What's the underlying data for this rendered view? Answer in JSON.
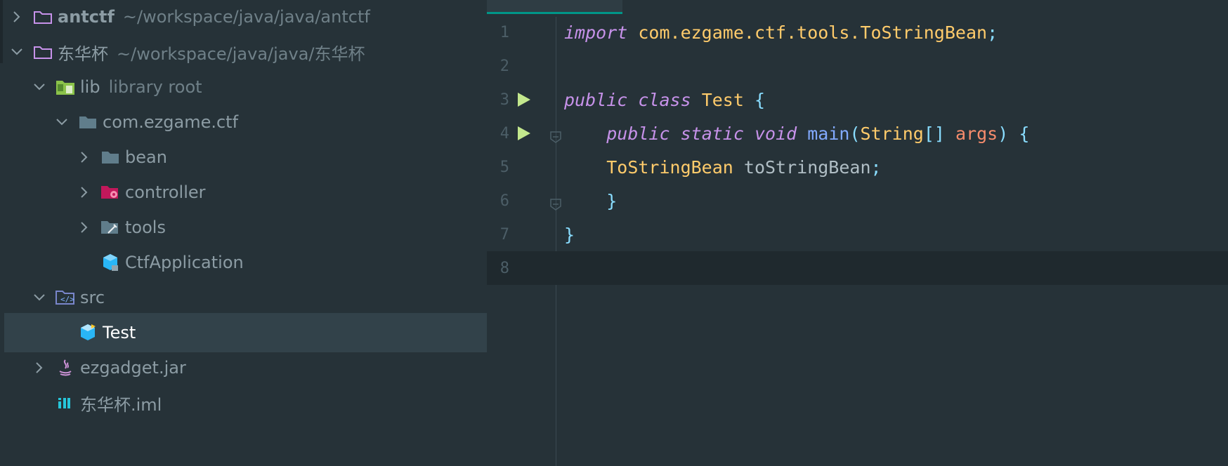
{
  "tree": {
    "items": [
      {
        "name": "antctf",
        "hint": "~/workspace/java/java/antctf",
        "icon": "folder-outline-icon",
        "chevron": "right",
        "bold": true
      },
      {
        "name": "东华杯",
        "hint": "~/workspace/java/java/东华杯",
        "icon": "folder-outline-icon",
        "chevron": "down"
      },
      {
        "name": "lib",
        "hint": "library root",
        "icon": "library-folder-icon",
        "chevron": "down"
      },
      {
        "name": "com.ezgame.ctf",
        "icon": "package-folder-icon",
        "chevron": "down"
      },
      {
        "name": "bean",
        "icon": "folder-icon",
        "chevron": "right"
      },
      {
        "name": "controller",
        "icon": "controller-folder-icon",
        "chevron": "right"
      },
      {
        "name": "tools",
        "icon": "tools-folder-icon",
        "chevron": "right"
      },
      {
        "name": "CtfApplication",
        "icon": "class-icon"
      },
      {
        "name": "src",
        "icon": "source-folder-icon",
        "chevron": "down"
      },
      {
        "name": "Test",
        "icon": "java-class-icon",
        "selected": true
      },
      {
        "name": "ezgadget.jar",
        "icon": "jar-icon",
        "chevron": "right"
      },
      {
        "name": "东华杯.iml",
        "icon": "iml-icon"
      }
    ]
  },
  "editor": {
    "lines": [
      {
        "num": "1",
        "tokens": [
          [
            "kw",
            "import"
          ],
          [
            "var",
            " "
          ],
          [
            "pkg",
            "com.ezgame.ctf.tools.ToStringBean"
          ],
          [
            "punc",
            ";"
          ]
        ]
      },
      {
        "num": "2",
        "tokens": []
      },
      {
        "num": "3",
        "run": true,
        "tokens": [
          [
            "kw",
            "public"
          ],
          [
            "var",
            " "
          ],
          [
            "kw",
            "class"
          ],
          [
            "var",
            " "
          ],
          [
            "cls",
            "Test"
          ],
          [
            "var",
            " "
          ],
          [
            "br",
            "{"
          ]
        ]
      },
      {
        "num": "4",
        "run": true,
        "fold": true,
        "tokens": [
          [
            "var",
            "    "
          ],
          [
            "kw",
            "public"
          ],
          [
            "var",
            " "
          ],
          [
            "kw",
            "static"
          ],
          [
            "var",
            " "
          ],
          [
            "kw",
            "void"
          ],
          [
            "var",
            " "
          ],
          [
            "fn",
            "main"
          ],
          [
            "br",
            "("
          ],
          [
            "cls",
            "String"
          ],
          [
            "br",
            "[]"
          ],
          [
            "var",
            " "
          ],
          [
            "par",
            "args"
          ],
          [
            "br",
            ")"
          ],
          [
            "var",
            " "
          ],
          [
            "br",
            "{"
          ]
        ]
      },
      {
        "num": "5",
        "tokens": [
          [
            "var",
            "    "
          ],
          [
            "cls",
            "ToStringBean"
          ],
          [
            "var",
            " toStringBean"
          ],
          [
            "punc",
            ";"
          ]
        ]
      },
      {
        "num": "6",
        "fold": true,
        "tokens": [
          [
            "var",
            "    "
          ],
          [
            "br",
            "}"
          ]
        ]
      },
      {
        "num": "7",
        "tokens": [
          [
            "br",
            "}"
          ]
        ]
      },
      {
        "num": "8",
        "current": true,
        "tokens": []
      }
    ]
  },
  "colors": {
    "background": "#263238",
    "selection": "#32424a",
    "accent": "#009688",
    "keyword": "#c792ea",
    "class": "#ffcb6b",
    "function": "#82aaff",
    "parameter": "#f78c6c",
    "run": "#c3e88d"
  }
}
